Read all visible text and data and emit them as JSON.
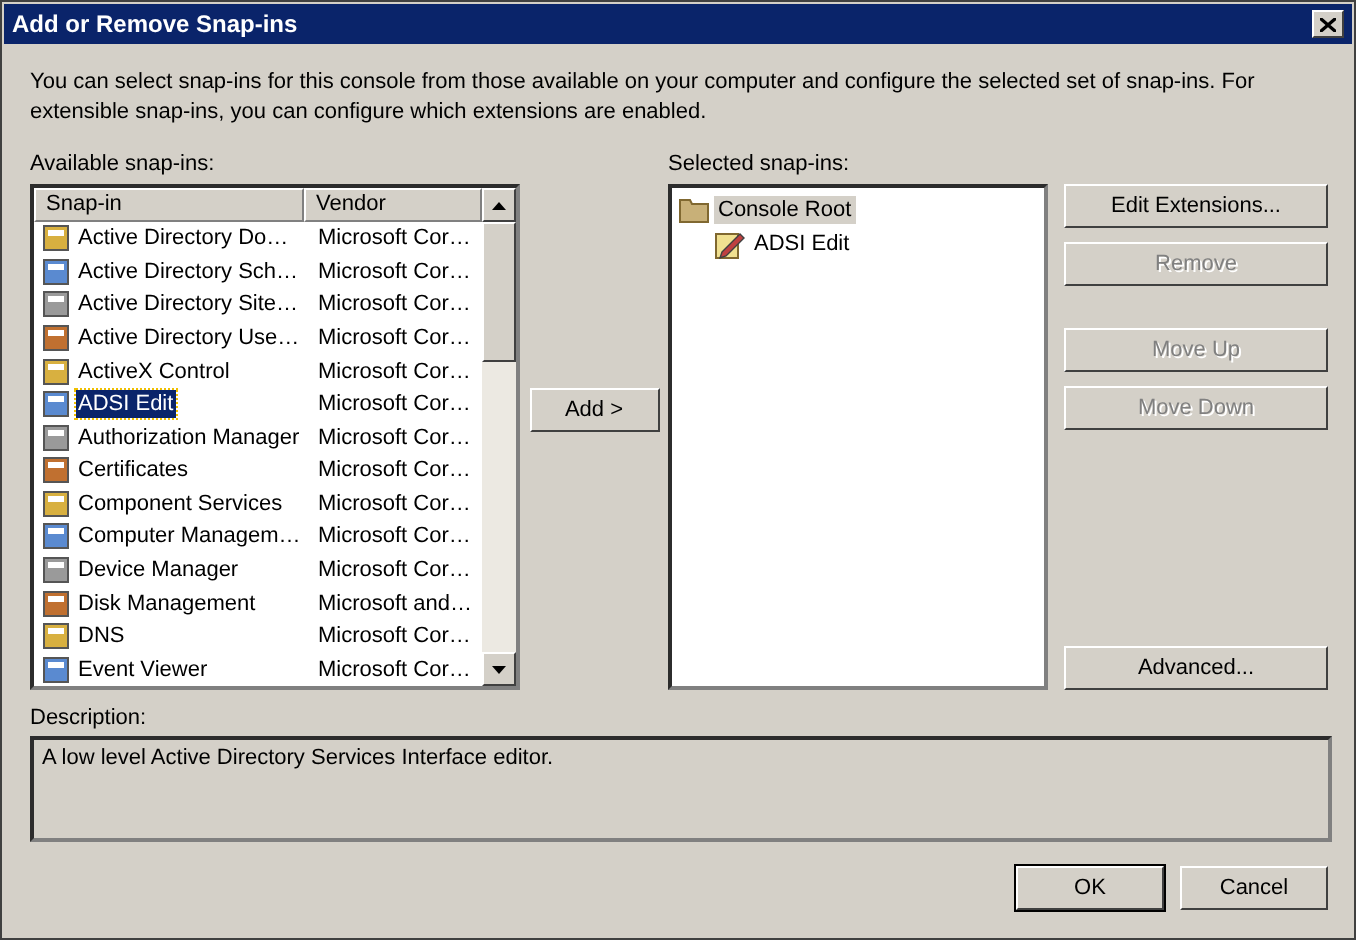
{
  "window": {
    "title": "Add or Remove Snap-ins"
  },
  "intro": "You can select snap-ins for this console from those available on your computer and configure the selected set of snap-ins. For extensible snap-ins, you can configure which extensions are enabled.",
  "available": {
    "label": "Available snap-ins:",
    "columns": [
      "Snap-in",
      "Vendor"
    ],
    "rows": [
      {
        "name": "Active Directory Do…",
        "vendor": "Microsoft Cor…",
        "selected": false
      },
      {
        "name": "Active Directory Sch…",
        "vendor": "Microsoft Cor…",
        "selected": false
      },
      {
        "name": "Active Directory Site…",
        "vendor": "Microsoft Cor…",
        "selected": false
      },
      {
        "name": "Active Directory Use…",
        "vendor": "Microsoft Cor…",
        "selected": false
      },
      {
        "name": "ActiveX Control",
        "vendor": "Microsoft Cor…",
        "selected": false
      },
      {
        "name": "ADSI Edit",
        "vendor": "Microsoft Cor…",
        "selected": true
      },
      {
        "name": "Authorization Manager",
        "vendor": "Microsoft Cor…",
        "selected": false
      },
      {
        "name": "Certificates",
        "vendor": "Microsoft Cor…",
        "selected": false
      },
      {
        "name": "Component Services",
        "vendor": "Microsoft Cor…",
        "selected": false
      },
      {
        "name": "Computer Managem…",
        "vendor": "Microsoft Cor…",
        "selected": false
      },
      {
        "name": "Device Manager",
        "vendor": "Microsoft Cor…",
        "selected": false
      },
      {
        "name": "Disk Management",
        "vendor": "Microsoft and…",
        "selected": false
      },
      {
        "name": "DNS",
        "vendor": "Microsoft Cor…",
        "selected": false
      },
      {
        "name": "Event Viewer",
        "vendor": "Microsoft Cor…",
        "selected": false
      }
    ]
  },
  "add_button": {
    "label": "Add >",
    "disabled": false
  },
  "selected_snapins": {
    "label": "Selected snap-ins:",
    "tree": [
      {
        "label": "Console Root",
        "selected": true,
        "children": [
          {
            "label": "ADSI Edit",
            "selected": false
          }
        ]
      }
    ]
  },
  "side_buttons": [
    {
      "label": "Edit Extensions...",
      "disabled": false
    },
    {
      "label": "Remove",
      "disabled": true
    },
    {
      "label": "Move Up",
      "disabled": true
    },
    {
      "label": "Move Down",
      "disabled": true
    },
    {
      "label": "Advanced...",
      "disabled": false
    }
  ],
  "description": {
    "label": "Description:",
    "text": "A low level Active Directory Services Interface editor."
  },
  "buttons": [
    {
      "label": "OK",
      "default": true
    },
    {
      "label": "Cancel",
      "default": false
    }
  ]
}
